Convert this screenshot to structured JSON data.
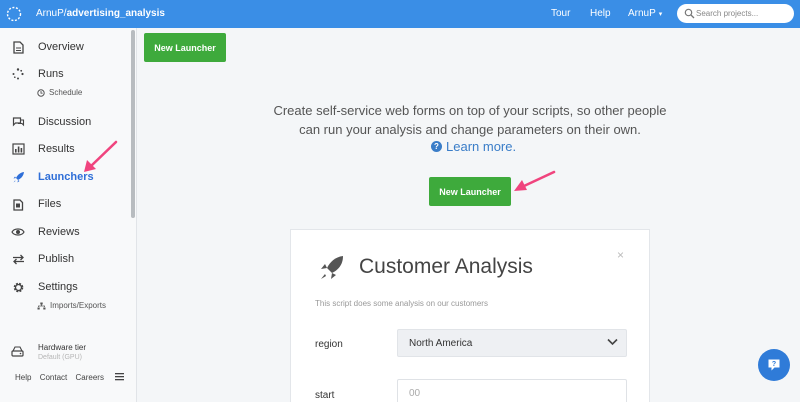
{
  "topbar": {
    "owner": "ArnuP/",
    "project": "advertising_analysis",
    "nav": {
      "tour": "Tour",
      "help": "Help",
      "user": "ArnuP"
    },
    "search_placeholder": "Search projects..."
  },
  "sidebar": {
    "items": [
      {
        "label": "Overview",
        "icon": "document-icon"
      },
      {
        "label": "Runs",
        "icon": "spinner-icon"
      },
      {
        "label": "Discussion",
        "icon": "chat-icon"
      },
      {
        "label": "Results",
        "icon": "chart-icon"
      },
      {
        "label": "Launchers",
        "icon": "rocket-icon",
        "active": true
      },
      {
        "label": "Files",
        "icon": "files-icon"
      },
      {
        "label": "Reviews",
        "icon": "eye-icon"
      },
      {
        "label": "Publish",
        "icon": "arrows-icon"
      },
      {
        "label": "Settings",
        "icon": "gear-icon"
      }
    ],
    "runs_sub": "Schedule",
    "settings_sub": "Imports/Exports",
    "hardware_label": "Hardware tier",
    "hardware_value": "Default (GPU)",
    "footer": {
      "help": "Help",
      "contact": "Contact",
      "careers": "Careers"
    }
  },
  "main": {
    "top_button": "New Launcher",
    "headline_line1": "Create self-service web forms on top of your scripts, so other people",
    "headline_line2": "can run your analysis and change parameters on their own.",
    "learn_more": "Learn more.",
    "center_button": "New Launcher",
    "card": {
      "title": "Customer Analysis",
      "description": "This script does some analysis on our customers",
      "field1_label": "region",
      "field1_value": "North America",
      "field2_label": "start",
      "field2_placeholder": "00"
    }
  },
  "colors": {
    "topbar": "#3a8ee6",
    "accent_green": "#3eaa3c",
    "active_link": "#2f6fd8",
    "annotation_arrow": "#f0447e"
  }
}
